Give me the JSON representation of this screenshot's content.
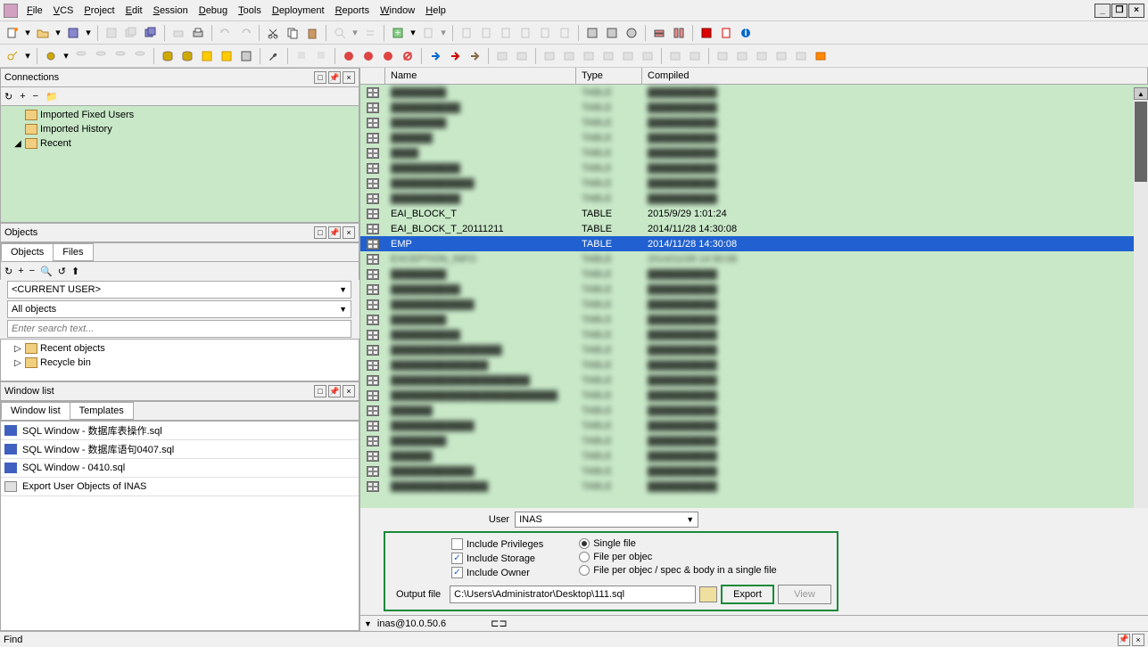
{
  "menu": [
    "File",
    "VCS",
    "Project",
    "Edit",
    "Session",
    "Debug",
    "Tools",
    "Deployment",
    "Reports",
    "Window",
    "Help"
  ],
  "panels": {
    "connections": {
      "title": "Connections",
      "items": [
        {
          "label": "Imported Fixed Users",
          "expand": ""
        },
        {
          "label": "Imported History",
          "expand": ""
        },
        {
          "label": "Recent",
          "expand": "◢"
        }
      ]
    },
    "objects": {
      "title": "Objects",
      "tabs": [
        "Objects",
        "Files"
      ],
      "user_combo": "<CURRENT USER>",
      "filter_combo": "All objects",
      "search_placeholder": "Enter search text...",
      "items": [
        {
          "label": "Recent objects",
          "expand": "▷"
        },
        {
          "label": "Recycle bin",
          "expand": "▷"
        }
      ]
    },
    "windowlist": {
      "title": "Window list",
      "tabs": [
        "Window list",
        "Templates"
      ],
      "items": [
        {
          "label": "SQL Window - 数据库表操作.sql",
          "type": "sql"
        },
        {
          "label": "SQL Window - 数据库语句0407.sql",
          "type": "sql"
        },
        {
          "label": "SQL Window - 0410.sql",
          "type": "sql"
        },
        {
          "label": "Export User Objects of INAS",
          "type": "export"
        }
      ]
    }
  },
  "table": {
    "columns": [
      "Name",
      "Type",
      "Compiled"
    ],
    "rows": [
      {
        "name": "████████",
        "type": "TABLE",
        "compiled": "██████████",
        "blur": true
      },
      {
        "name": "██████████",
        "type": "TABLE",
        "compiled": "██████████",
        "blur": true
      },
      {
        "name": "████████",
        "type": "TABLE",
        "compiled": "██████████",
        "blur": true
      },
      {
        "name": "██████",
        "type": "TABLE",
        "compiled": "██████████",
        "blur": true
      },
      {
        "name": "████",
        "type": "TABLE",
        "compiled": "██████████",
        "blur": true
      },
      {
        "name": "██████████",
        "type": "TABLE",
        "compiled": "██████████",
        "blur": true
      },
      {
        "name": "████████████",
        "type": "TABLE",
        "compiled": "██████████",
        "blur": true
      },
      {
        "name": "██████████",
        "type": "TABLE",
        "compiled": "██████████",
        "blur": true
      },
      {
        "name": "EAI_BLOCK_T",
        "type": "TABLE",
        "compiled": "2015/9/29 1:01:24",
        "blur": false
      },
      {
        "name": "EAI_BLOCK_T_20111211",
        "type": "TABLE",
        "compiled": "2014/11/28 14:30:08",
        "blur": false
      },
      {
        "name": "EMP",
        "type": "TABLE",
        "compiled": "2014/11/28 14:30:08",
        "blur": false,
        "selected": true
      },
      {
        "name": "EXCEPTION_INFO",
        "type": "TABLE",
        "compiled": "2014/11/28 14:30:08",
        "blur": true
      },
      {
        "name": "████████",
        "type": "TABLE",
        "compiled": "██████████",
        "blur": true
      },
      {
        "name": "██████████",
        "type": "TABLE",
        "compiled": "██████████",
        "blur": true
      },
      {
        "name": "████████████",
        "type": "TABLE",
        "compiled": "██████████",
        "blur": true
      },
      {
        "name": "████████",
        "type": "TABLE",
        "compiled": "██████████",
        "blur": true
      },
      {
        "name": "██████████",
        "type": "TABLE",
        "compiled": "██████████",
        "blur": true
      },
      {
        "name": "████████████████",
        "type": "TABLE",
        "compiled": "██████████",
        "blur": true
      },
      {
        "name": "██████████████",
        "type": "TABLE",
        "compiled": "██████████",
        "blur": true
      },
      {
        "name": "████████████████████",
        "type": "TABLE",
        "compiled": "██████████",
        "blur": true
      },
      {
        "name": "████████████████████████",
        "type": "TABLE",
        "compiled": "██████████",
        "blur": true
      },
      {
        "name": "██████",
        "type": "TABLE",
        "compiled": "██████████",
        "blur": true
      },
      {
        "name": "████████████",
        "type": "TABLE",
        "compiled": "██████████",
        "blur": true
      },
      {
        "name": "████████",
        "type": "TABLE",
        "compiled": "██████████",
        "blur": true
      },
      {
        "name": "██████",
        "type": "TABLE",
        "compiled": "██████████",
        "blur": true
      },
      {
        "name": "████████████",
        "type": "TABLE",
        "compiled": "██████████",
        "blur": true
      },
      {
        "name": "██████████████",
        "type": "TABLE",
        "compiled": "██████████",
        "blur": true
      }
    ]
  },
  "export": {
    "user_label": "User",
    "user_value": "INAS",
    "include_privileges": "Include Privileges",
    "include_storage": "Include Storage",
    "include_owner": "Include Owner",
    "single_file": "Single file",
    "file_per_obj": "File per objec",
    "file_per_obj_spec": "File per objec  / spec & body in a single file",
    "output_label": "Output file",
    "output_path": "C:\\Users\\Administrator\\Desktop\\111.sql",
    "export_btn": "Export",
    "view_btn": "View"
  },
  "status": {
    "connection": "inas@10.0.50.6"
  },
  "find": {
    "label": "Find"
  }
}
